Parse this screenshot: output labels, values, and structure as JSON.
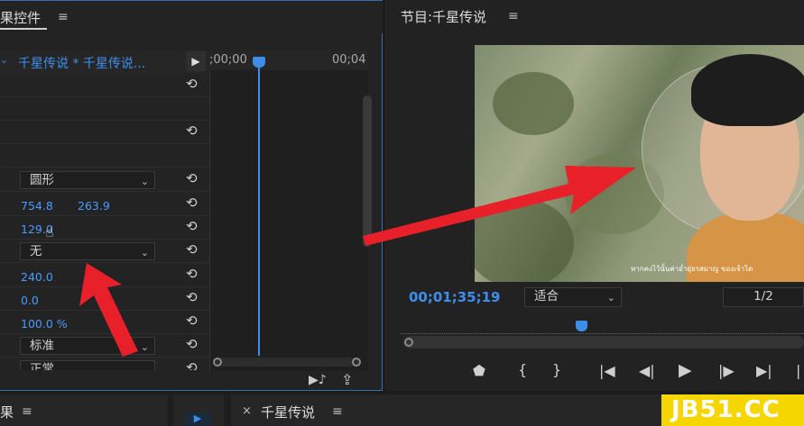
{
  "left_panel": {
    "tab_title": "果控件",
    "menu_icon": "≡",
    "sequence_label": "千星传说 * 千星传说...",
    "ruler_start": ";00;00",
    "ruler_end": "00;04",
    "rows": {
      "shape_dropdown": "圆形",
      "center_x": "754.8",
      "center_y": "263.9",
      "value_129": "129.0",
      "none_dropdown": "无",
      "value_240": "240.0",
      "value_0": "0.0",
      "value_percent": "100.0 %",
      "blend_dropdown": "标准",
      "partial_dropdown": "正常"
    }
  },
  "program_monitor": {
    "title": "节目:千星传说",
    "menu_icon": "≡",
    "timecode": "00;01;35;19",
    "fit_label": "适合",
    "resolution": "1/2",
    "subtitle": "หากคงไว้นั้นค่าย่ำยุ่ยรสมาญ ของเจ้าได"
  },
  "bottom_bar": {
    "left_tab": "果",
    "menu_icon": "≡",
    "close_icon": "×",
    "sequence_tab": "千星传说"
  },
  "watermark": "JB51.CC"
}
